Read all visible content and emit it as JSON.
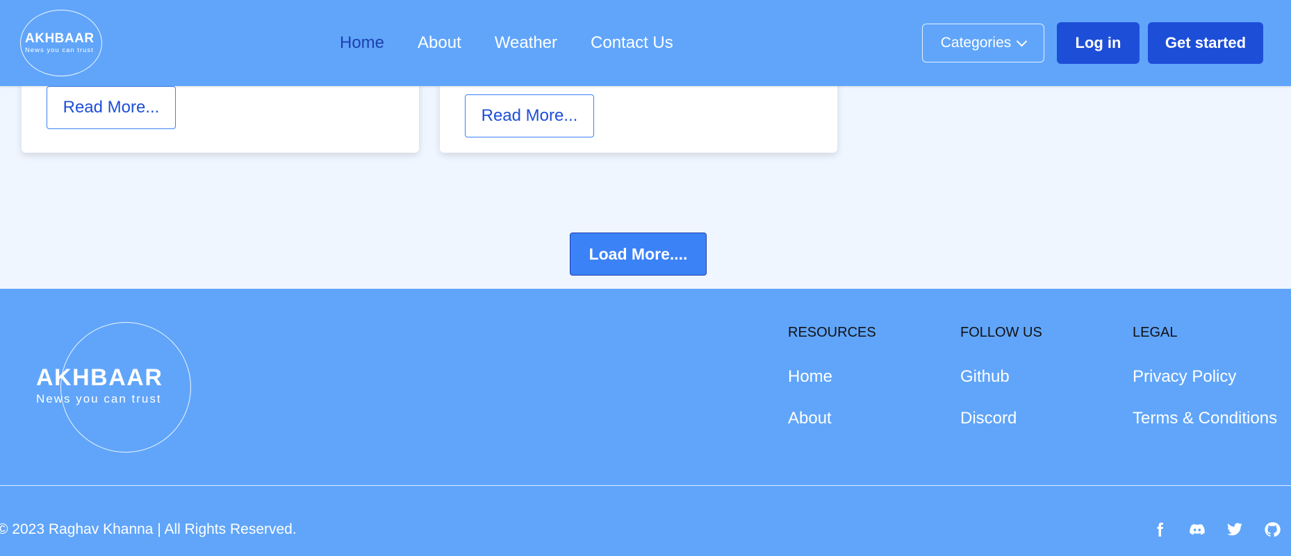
{
  "nav": {
    "logo_brand": "AKHBAAR",
    "logo_tagline": "News you can trust",
    "links": [
      "Home",
      "About",
      "Weather",
      "Contact Us"
    ],
    "categories_label": "Categories",
    "login_label": "Log in",
    "get_started_label": "Get started"
  },
  "cards": [
    {
      "read_more_label": "Read More..."
    },
    {
      "excerpt": "",
      "read_more_label": "Read More..."
    }
  ],
  "load_more_label": "Load More....",
  "footer": {
    "logo_brand": "AKHBAAR",
    "logo_tagline": "News you can trust",
    "resources": {
      "heading": "RESOURCES",
      "links": [
        "Home",
        "About"
      ]
    },
    "follow_us": {
      "heading": "FOLLOW US",
      "links": [
        "Github",
        "Discord"
      ]
    },
    "legal": {
      "heading": "LEGAL",
      "links": [
        "Privacy Policy",
        "Terms & Conditions"
      ]
    },
    "copyright": "© 2023 Raghav Khanna | All Rights Reserved.",
    "social_icons": [
      "facebook-icon",
      "discord-icon",
      "twitter-icon",
      "github-icon"
    ]
  },
  "colors": {
    "primary": "#60a5fa",
    "accent_dark": "#1d4ed8",
    "accent": "#3b82f6",
    "background": "#eff6ff"
  }
}
